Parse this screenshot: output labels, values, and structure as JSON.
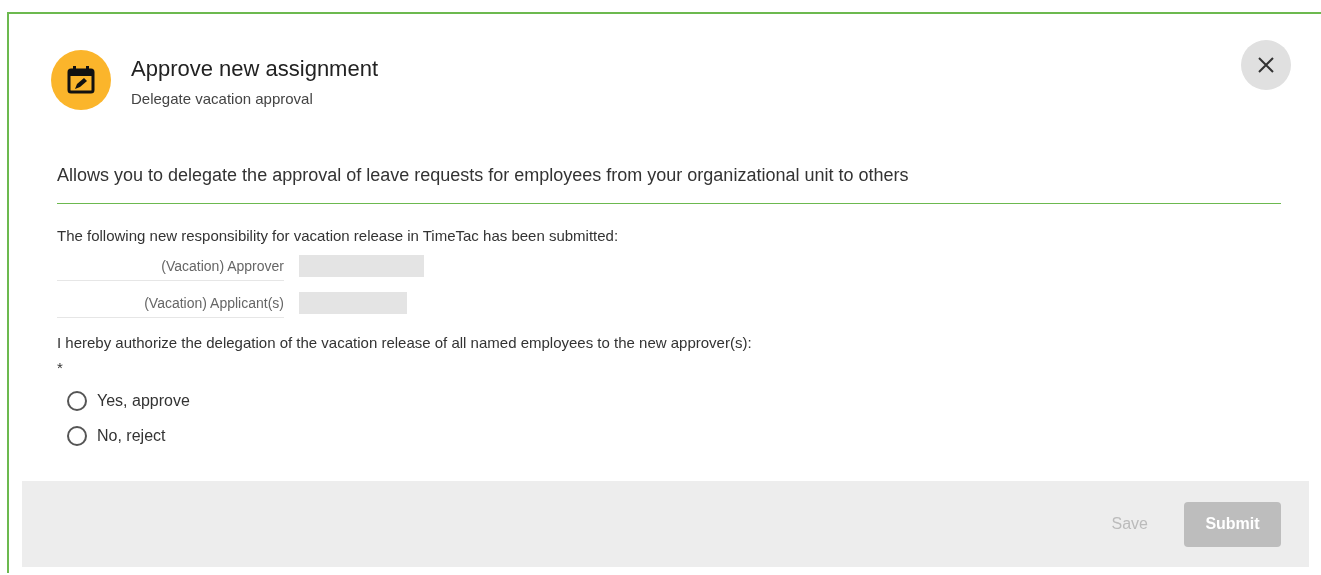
{
  "dialog": {
    "title": "Approve new assignment",
    "subtitle": "Delegate vacation approval"
  },
  "description": "Allows you to delegate the approval of leave requests for employees from your organizational unit to others",
  "intro": "The following new responsibility for vacation release in TimeTac has been submitted:",
  "fields": [
    {
      "label": "(Vacation) Approver"
    },
    {
      "label": "(Vacation) Applicant(s)"
    }
  ],
  "question": "I hereby authorize the delegation of the vacation release of all named employees to the new approver(s): *",
  "options": [
    {
      "label": "Yes, approve",
      "selected": false
    },
    {
      "label": "No, reject",
      "selected": false
    }
  ],
  "buttons": [
    {
      "label": "Save",
      "kind": "text",
      "disabled": true
    },
    {
      "label": "Submit",
      "kind": "primary",
      "disabled": true
    }
  ]
}
